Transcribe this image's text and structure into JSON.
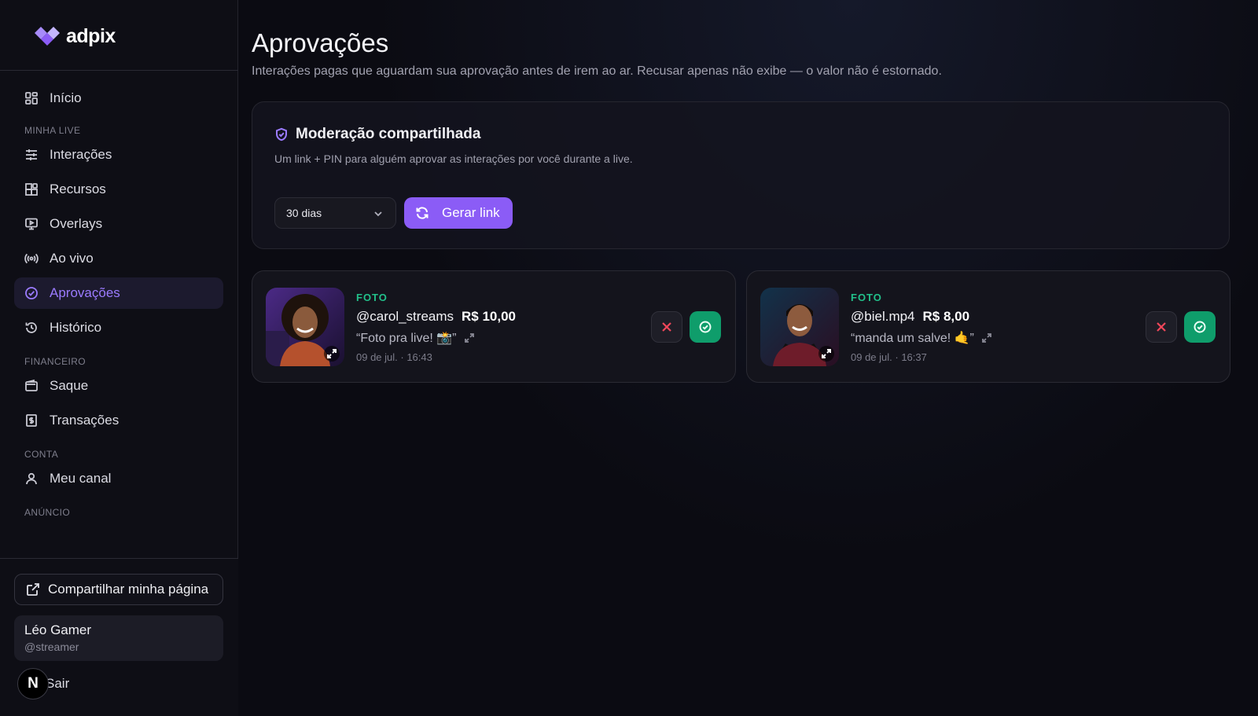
{
  "brand": {
    "name": "adpix"
  },
  "sidebar": {
    "home": "Início",
    "sections": {
      "live": "MINHA LIVE",
      "finance": "FINANCEIRO",
      "account": "CONTA",
      "ads": "ANÚNCIO"
    },
    "items": {
      "interacoes": "Interações",
      "recursos": "Recursos",
      "overlays": "Overlays",
      "aovivo": "Ao vivo",
      "aprovacoes": "Aprovações",
      "historico": "Histórico",
      "saque": "Saque",
      "transacoes": "Transações",
      "canal": "Meu canal"
    },
    "share_label": "Compartilhar minha página",
    "user": {
      "name": "Léo Gamer",
      "handle": "@streamer"
    },
    "logout_label": "Sair",
    "badge_letter": "N"
  },
  "page": {
    "title": "Aprovações",
    "subtitle": "Interações pagas que aguardam sua aprovação antes de irem ao ar. Recusar apenas não exibe — o valor não é estornado."
  },
  "moderation": {
    "title": "Moderação compartilhada",
    "description": "Um link + PIN para alguém aprovar as interações por você durante a live.",
    "duration_value": "30 dias",
    "generate_label": "Gerar link"
  },
  "pending": [
    {
      "kind": "FOTO",
      "handle": "@carol_streams",
      "amount": "R$ 10,00",
      "message": "“Foto pra live! 📸”",
      "timestamp": "09 de jul. · 16:43"
    },
    {
      "kind": "FOTO",
      "handle": "@biel.mp4",
      "amount": "R$ 8,00",
      "message": "“manda um salve! 🤙”",
      "timestamp": "09 de jul. · 16:37"
    }
  ],
  "colors": {
    "accent": "#8b5cf6",
    "active_text": "#9b7bff",
    "approve": "#0f9d6b",
    "reject": "#f0465a",
    "kind_label": "#22c08a"
  }
}
